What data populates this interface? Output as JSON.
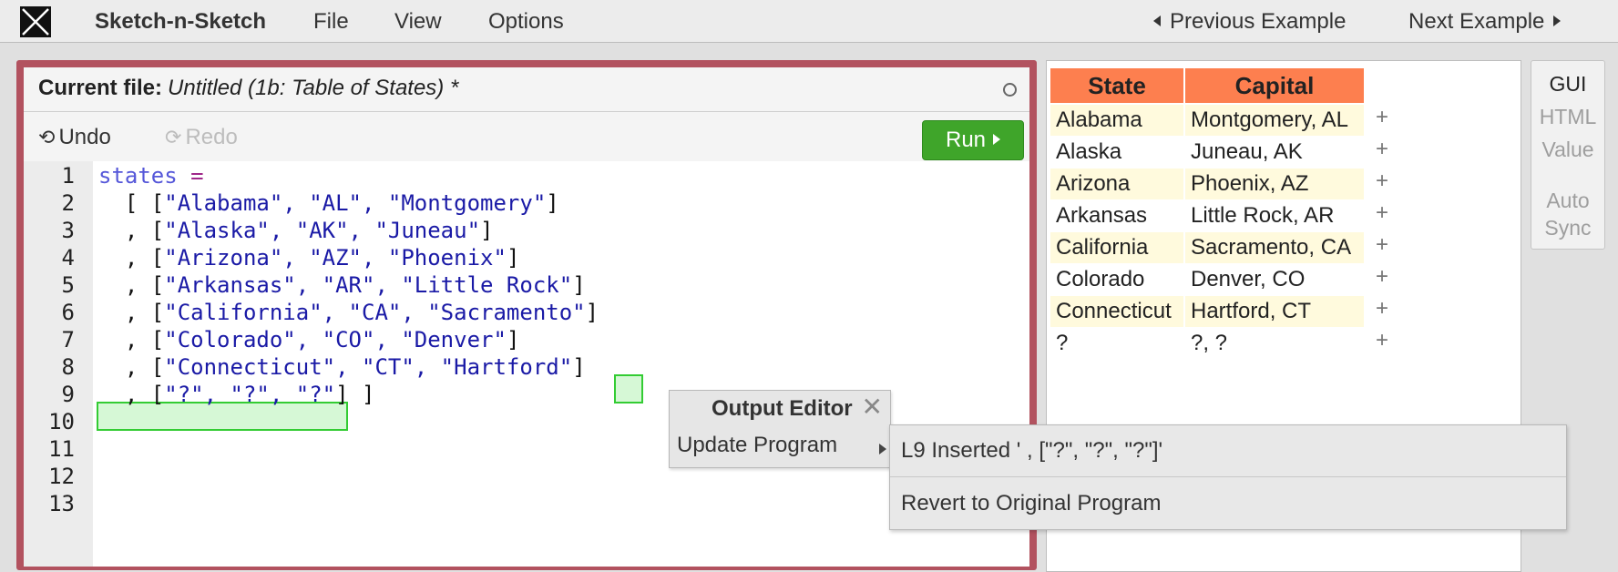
{
  "app": {
    "title": "Sketch-n-Sketch",
    "menus": [
      "File",
      "View",
      "Options"
    ],
    "prev_example": "Previous Example",
    "next_example": "Next Example"
  },
  "editor": {
    "file_label": "Current file:",
    "file_name": "Untitled (1b: Table of States) *",
    "undo_label": "Undo",
    "redo_label": "Redo",
    "run_label": "Run",
    "line_numbers": [
      "1",
      "2",
      "3",
      "4",
      "5",
      "6",
      "7",
      "8",
      "9",
      "10",
      "11",
      "12",
      "13"
    ],
    "code": {
      "l1_kw": "states",
      "l1_op": "=",
      "l2_pre": "  [ [",
      "l2_s": "\"Alabama\", \"AL\", \"Montgomery\"",
      "l2_post": "]",
      "l3_pre": "  , [",
      "l3_s": "\"Alaska\", \"AK\", \"Juneau\"",
      "l3_post": "]",
      "l4_pre": "  , [",
      "l4_s": "\"Arizona\", \"AZ\", \"Phoenix\"",
      "l4_post": "]",
      "l5_pre": "  , [",
      "l5_s": "\"Arkansas\", \"AR\", \"Little Rock\"",
      "l5_post": "]",
      "l6_pre": "  , [",
      "l6_s": "\"California\", \"CA\", \"Sacramento\"",
      "l6_post": "]",
      "l7_pre": "  , [",
      "l7_s": "\"Colorado\", \"CO\", \"Denver\"",
      "l7_post": "]",
      "l8_pre": "  , [",
      "l8_s": "\"Connecticut\", \"CT\", \"Hartford\"",
      "l8_post": "]",
      "l9_pre": "  , [",
      "l9_s": "\"?\", \"?\", \"?\"",
      "l9_post": "] ]"
    }
  },
  "output": {
    "headers": [
      "State",
      "Capital"
    ],
    "rows": [
      {
        "state": "Alabama",
        "capital": "Montgomery, AL"
      },
      {
        "state": "Alaska",
        "capital": "Juneau, AK"
      },
      {
        "state": "Arizona",
        "capital": "Phoenix, AZ"
      },
      {
        "state": "Arkansas",
        "capital": "Little Rock, AR"
      },
      {
        "state": "California",
        "capital": "Sacramento, CA"
      },
      {
        "state": "Colorado",
        "capital": "Denver, CO"
      },
      {
        "state": "Connecticut",
        "capital": "Hartford, CT"
      },
      {
        "state": "?",
        "capital": "?, ?"
      }
    ],
    "plus": "+"
  },
  "modes": {
    "gui": "GUI",
    "html": "HTML",
    "value": "Value",
    "auto": "Auto",
    "sync": "Sync"
  },
  "popup": {
    "title": "Output Editor",
    "close": "✕",
    "update_program": "Update Program",
    "option_inserted": "L9 Inserted ' , [\"?\", \"?\", \"?\"]'",
    "option_revert": "Revert to Original Program"
  },
  "colors": {
    "editor_border": "#b2525f",
    "run_button": "#3fa52a",
    "table_header": "#fd7f4f",
    "table_row_highlight": "#fffadd",
    "insert_highlight": "#33cc33"
  }
}
